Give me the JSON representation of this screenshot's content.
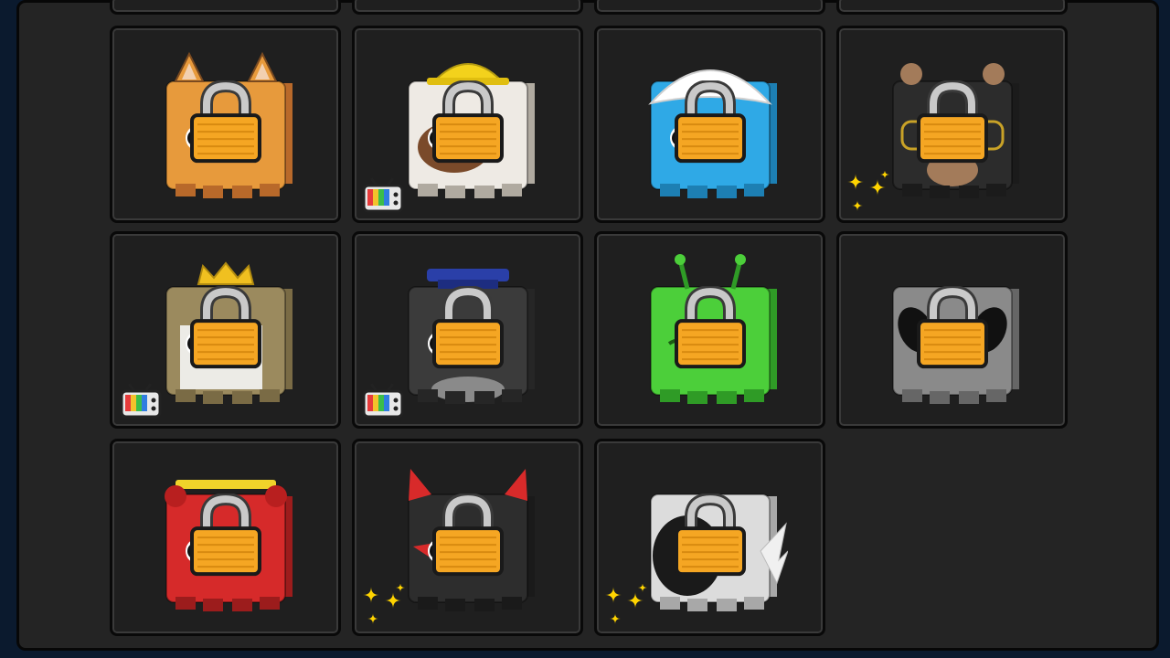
{
  "inventory": {
    "slots": [
      {
        "pet": "fox",
        "locked": true,
        "badge": null,
        "colors": {
          "body": "#e79a3c",
          "side": "#b8692a",
          "accent": "#f2e7cf"
        }
      },
      {
        "pet": "raccoon-hardhat",
        "locked": true,
        "badge": "tv-icon",
        "colors": {
          "body": "#eeeae4",
          "side": "#b0aaa0",
          "accent": "#7a4a2a"
        }
      },
      {
        "pet": "blue-cat-wizard",
        "locked": true,
        "badge": null,
        "colors": {
          "body": "#2fa9e6",
          "side": "#1d7fb3",
          "accent": "#ffffff"
        }
      },
      {
        "pet": "black-bear-glasses",
        "locked": true,
        "badge": "sparkle-icon",
        "colors": {
          "body": "#2c2c2c",
          "side": "#1b1b1b",
          "accent": "#a37b5a"
        }
      },
      {
        "pet": "king-bird",
        "locked": true,
        "badge": "tv-icon",
        "colors": {
          "body": "#9b8a5e",
          "side": "#7a6b45",
          "accent": "#ecebe6"
        }
      },
      {
        "pet": "police-raccoon",
        "locked": true,
        "badge": "tv-icon",
        "colors": {
          "body": "#3b3b3b",
          "side": "#262626",
          "accent": "#8a8a8a"
        }
      },
      {
        "pet": "green-bug",
        "locked": true,
        "badge": null,
        "colors": {
          "body": "#4ccf3a",
          "side": "#2f9b26",
          "accent": "#3a9a2e"
        }
      },
      {
        "pet": "alien",
        "locked": true,
        "badge": null,
        "colors": {
          "body": "#8a8a8a",
          "side": "#666666",
          "accent": "#111111"
        }
      },
      {
        "pet": "red-demon",
        "locked": true,
        "badge": null,
        "colors": {
          "body": "#d62a2a",
          "side": "#9c1c1c",
          "accent": "#f0d32a"
        }
      },
      {
        "pet": "dark-demon",
        "locked": true,
        "badge": "sparkle-icon",
        "colors": {
          "body": "#2d2d2d",
          "side": "#1a1a1a",
          "accent": "#e23030"
        }
      },
      {
        "pet": "angel-hood",
        "locked": true,
        "badge": "sparkle-icon",
        "colors": {
          "body": "#dcdcdc",
          "side": "#a8a8a8",
          "accent": "#ffffff"
        }
      }
    ]
  },
  "theme": {
    "lock_body": "#f5a623",
    "lock_shackle": "#c9c9c9",
    "sparkle": "#ffd400"
  }
}
